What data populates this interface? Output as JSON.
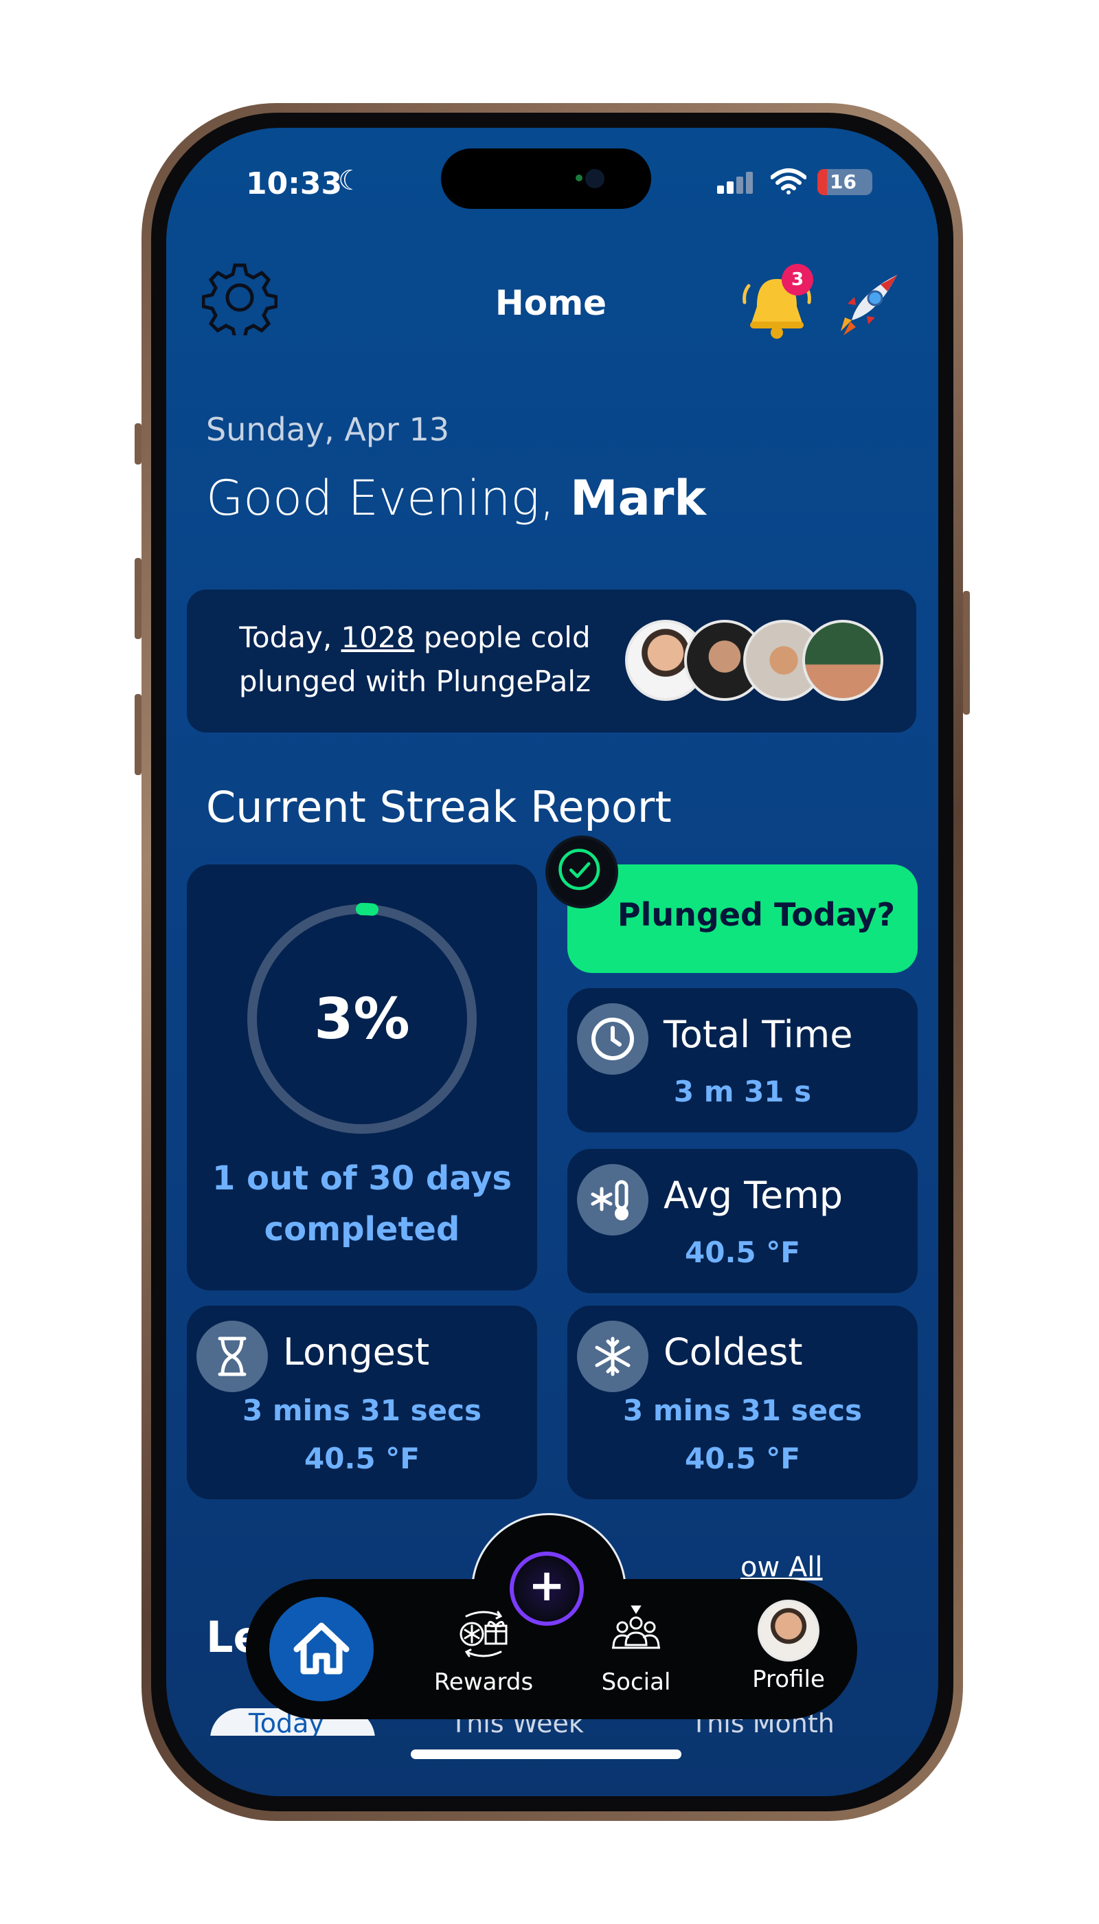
{
  "status_bar": {
    "time": "10:33",
    "battery": "16"
  },
  "header": {
    "title": "Home",
    "notification_count": "3"
  },
  "greeting": {
    "date": "Sunday, Apr 13",
    "salutation": "Good Evening,",
    "name": "Mark"
  },
  "community": {
    "prefix": "Today,",
    "count": "1028",
    "suffix": "people cold",
    "line2": "plunged with PlungePalz"
  },
  "streak": {
    "section_title": "Current Streak Report",
    "progress_percent": 3,
    "progress_label": "3%",
    "caption_line1": "1 out of 30 days",
    "caption_line2": "completed"
  },
  "plunge_button": {
    "label": "Plunged Today?"
  },
  "stats": {
    "total_time": {
      "label": "Total Time",
      "value": "3 m 31 s"
    },
    "avg_temp": {
      "label": "Avg Temp",
      "value": "40.5 °F"
    },
    "longest": {
      "label": "Longest",
      "value_time": "3 mins 31 secs",
      "value_temp": "40.5 °F"
    },
    "coldest": {
      "label": "Coldest",
      "value_time": "3 mins 31 secs",
      "value_temp": "40.5 °F"
    }
  },
  "leaderboard": {
    "title_partial": "Le",
    "see_all_partial": "ow All",
    "tabs": [
      "Today",
      "This Week",
      "This Month"
    ]
  },
  "nav": {
    "items": [
      {
        "label": "Rewards",
        "icon": "rewards-icon"
      },
      {
        "label": "Social",
        "icon": "social-icon"
      },
      {
        "label": "Profile",
        "icon": "profile-avatar"
      }
    ]
  },
  "colors": {
    "accent_green": "#0ee57e",
    "accent_blue": "#6fb1ff",
    "badge_red": "#e91e63",
    "fab_purple": "#7b3cff"
  }
}
